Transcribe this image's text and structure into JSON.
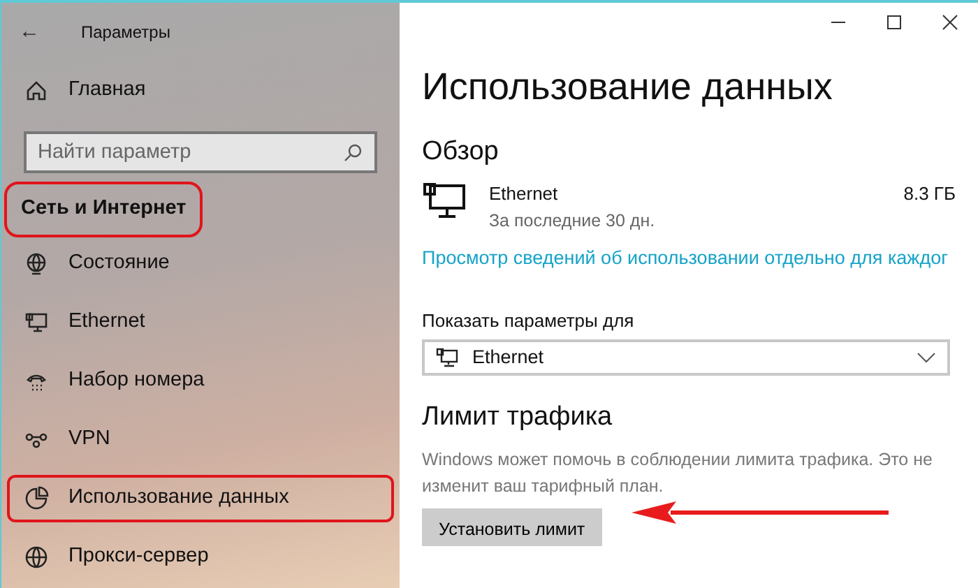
{
  "window": {
    "title": "Параметры",
    "back": "←"
  },
  "sidebar": {
    "home": {
      "label": "Главная"
    },
    "search": {
      "placeholder": "Найти параметр"
    },
    "section": {
      "label": "Сеть и Интернет",
      "highlighted": true
    },
    "items": [
      {
        "kind": "status",
        "label": "Состояние",
        "highlighted": false
      },
      {
        "kind": "ethernet",
        "label": "Ethernet",
        "highlighted": false
      },
      {
        "kind": "dialup",
        "label": "Набор номера",
        "highlighted": false
      },
      {
        "kind": "vpn",
        "label": "VPN",
        "highlighted": false
      },
      {
        "kind": "data",
        "label": "Использование данных",
        "highlighted": true
      },
      {
        "kind": "proxy",
        "label": "Прокси-сервер",
        "highlighted": false
      }
    ]
  },
  "page": {
    "title": "Использование данных",
    "overview": {
      "heading": "Обзор",
      "network": "Ethernet",
      "period": "За последние 30 дн.",
      "amount": "8.3 ГБ",
      "link": "Просмотр сведений об использовании отдельно для каждог"
    },
    "show_for": {
      "label": "Показать параметры для",
      "value": "Ethernet"
    },
    "limit": {
      "heading": "Лимит трафика",
      "description": "Windows может помочь в соблюдении лимита трафика. Это не изменит ваш тарифный план.",
      "button": "Установить лимит",
      "arrow": true
    }
  }
}
